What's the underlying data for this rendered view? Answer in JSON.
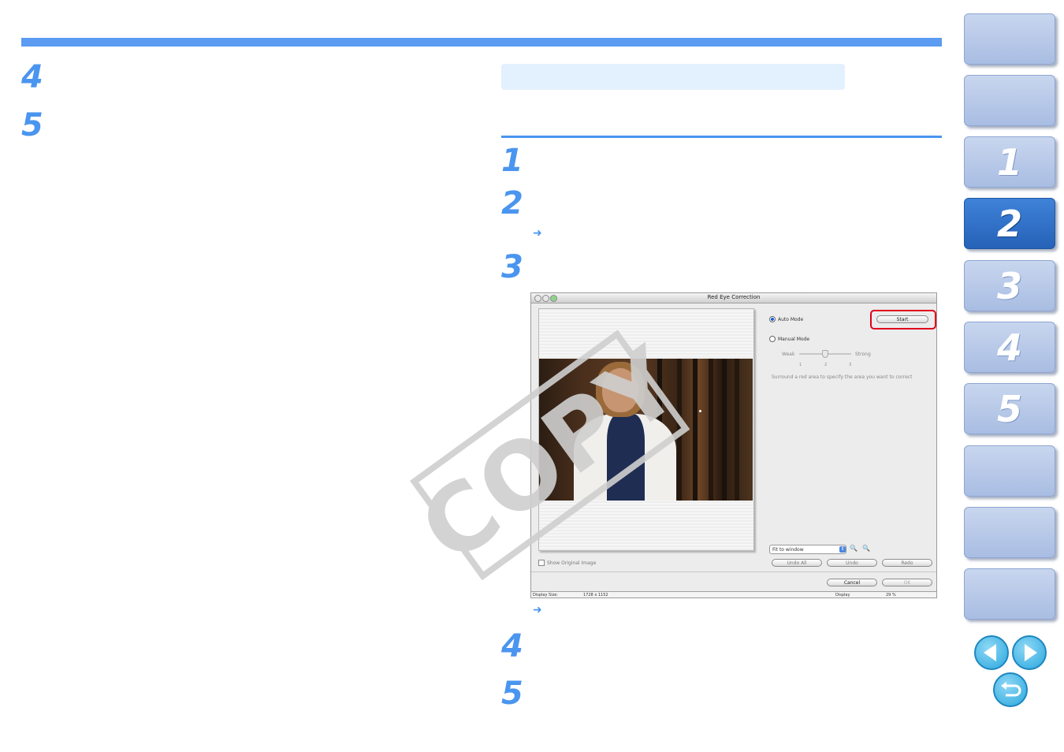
{
  "steps_left": [
    "4",
    "5"
  ],
  "steps_right": [
    "1",
    "2",
    "3",
    "4",
    "5"
  ],
  "arrows": [
    "➜",
    "➜"
  ],
  "watermark": "COPY",
  "side_nav": {
    "chapters": [
      "1",
      "2",
      "3",
      "4",
      "5"
    ],
    "active_chapter": "2"
  },
  "dialog": {
    "title": "Red Eye Correction",
    "auto_mode_label": "Auto Mode",
    "start_label": "Start",
    "manual_mode_label": "Manual Mode",
    "weak_label": "Weak",
    "strong_label": "Strong",
    "ticks": [
      "1",
      "2",
      "3"
    ],
    "instruction": "Surround a red area to specify the area you want to correct",
    "fit_select_value": "Fit to window",
    "show_original_label": "Show Original Image",
    "undo_all_label": "Undo All",
    "undo_label": "Undo",
    "redo_label": "Redo",
    "cancel_label": "Cancel",
    "ok_label": "OK",
    "status": {
      "display_size_label": "Display Size:",
      "display_size_value": "1728 x 1152",
      "display_label": "Display",
      "display_value": "29 %"
    }
  },
  "colors": {
    "accent": "#4a95ef",
    "highlight_ring": "#e0001b",
    "nav_active": "#2562b8"
  }
}
